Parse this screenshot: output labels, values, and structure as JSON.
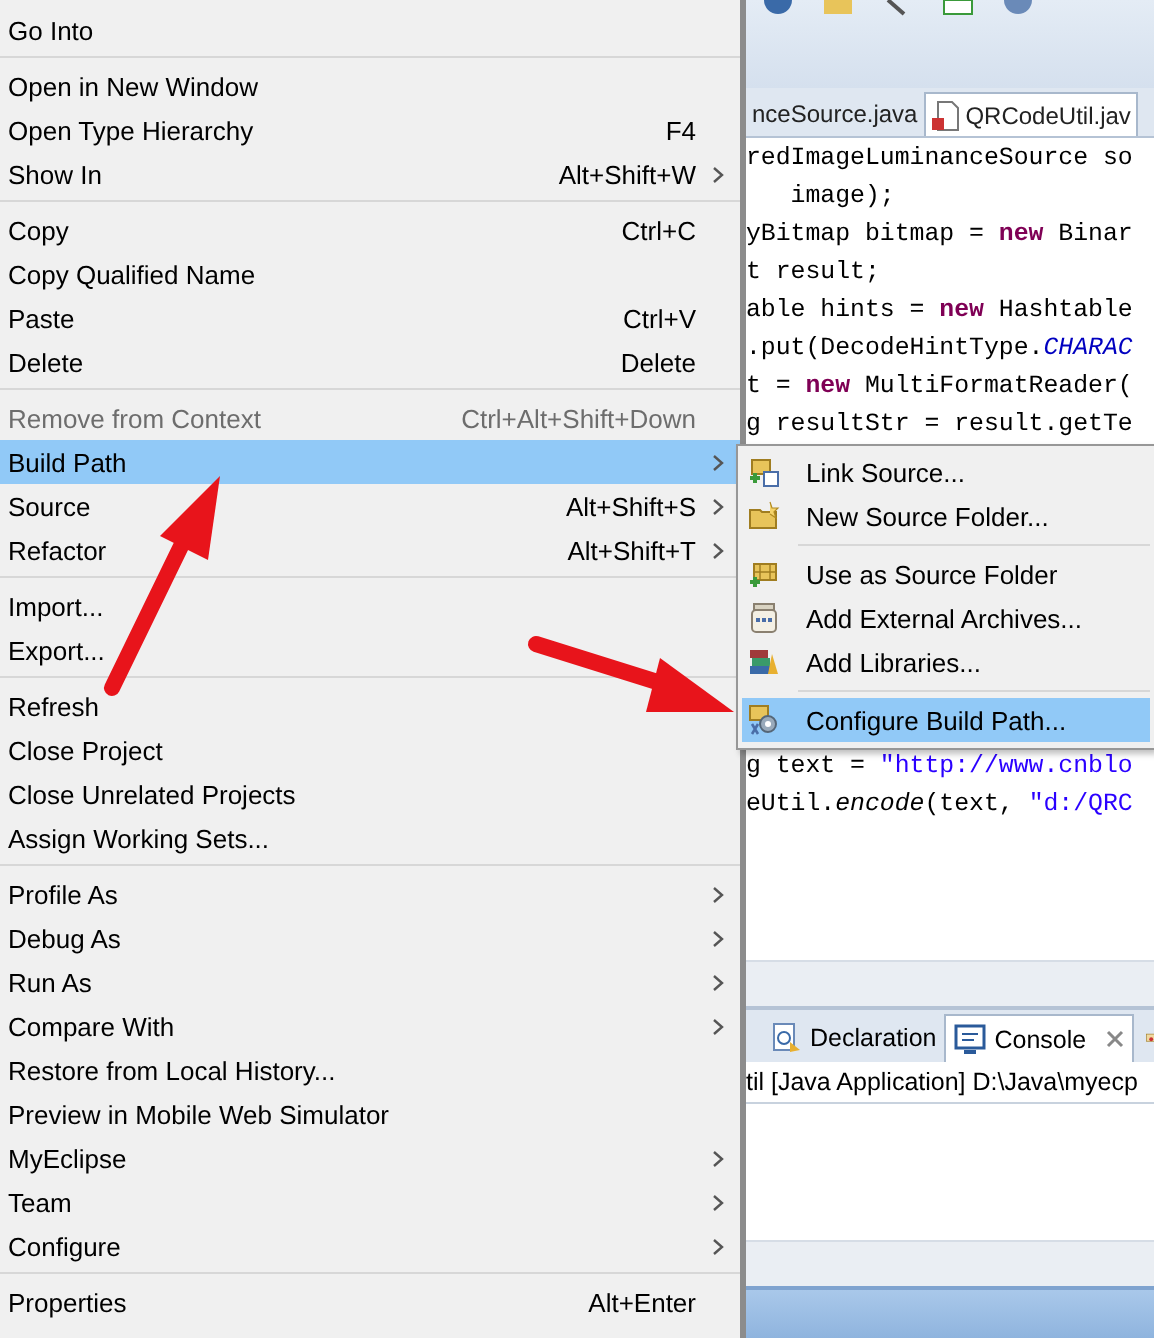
{
  "context_menu": {
    "items": [
      {
        "kind": "item",
        "label": "Go Into",
        "has_submenu": false,
        "disabled": false,
        "selected": false
      },
      {
        "kind": "separator"
      },
      {
        "kind": "item",
        "label": "Open in New Window",
        "has_submenu": false,
        "disabled": false,
        "selected": false
      },
      {
        "kind": "item",
        "label": "Open Type Hierarchy",
        "shortcut": "F4",
        "has_submenu": false,
        "disabled": false,
        "selected": false
      },
      {
        "kind": "item",
        "label": "Show In",
        "shortcut": "Alt+Shift+W",
        "has_submenu": true,
        "disabled": false,
        "selected": false
      },
      {
        "kind": "separator"
      },
      {
        "kind": "item",
        "label": "Copy",
        "shortcut": "Ctrl+C",
        "has_submenu": false,
        "disabled": false,
        "selected": false
      },
      {
        "kind": "item",
        "label": "Copy Qualified Name",
        "has_submenu": false,
        "disabled": false,
        "selected": false
      },
      {
        "kind": "item",
        "label": "Paste",
        "shortcut": "Ctrl+V",
        "has_submenu": false,
        "disabled": false,
        "selected": false
      },
      {
        "kind": "item",
        "label": "Delete",
        "shortcut": "Delete",
        "has_submenu": false,
        "disabled": false,
        "selected": false
      },
      {
        "kind": "separator"
      },
      {
        "kind": "item",
        "label": "Remove from Context",
        "shortcut": "Ctrl+Alt+Shift+Down",
        "has_submenu": false,
        "disabled": true,
        "selected": false
      },
      {
        "kind": "item",
        "label": "Build Path",
        "has_submenu": true,
        "disabled": false,
        "selected": true
      },
      {
        "kind": "item",
        "label": "Source",
        "shortcut": "Alt+Shift+S",
        "has_submenu": true,
        "disabled": false,
        "selected": false
      },
      {
        "kind": "item",
        "label": "Refactor",
        "shortcut": "Alt+Shift+T",
        "has_submenu": true,
        "disabled": false,
        "selected": false
      },
      {
        "kind": "separator"
      },
      {
        "kind": "item",
        "label": "Import...",
        "has_submenu": false,
        "disabled": false,
        "selected": false
      },
      {
        "kind": "item",
        "label": "Export...",
        "has_submenu": false,
        "disabled": false,
        "selected": false
      },
      {
        "kind": "separator"
      },
      {
        "kind": "item",
        "label": "Refresh",
        "has_submenu": false,
        "disabled": false,
        "selected": false
      },
      {
        "kind": "item",
        "label": "Close Project",
        "has_submenu": false,
        "disabled": false,
        "selected": false
      },
      {
        "kind": "item",
        "label": "Close Unrelated Projects",
        "has_submenu": false,
        "disabled": false,
        "selected": false
      },
      {
        "kind": "item",
        "label": "Assign Working Sets...",
        "has_submenu": false,
        "disabled": false,
        "selected": false
      },
      {
        "kind": "separator"
      },
      {
        "kind": "item",
        "label": "Profile As",
        "has_submenu": true,
        "disabled": false,
        "selected": false
      },
      {
        "kind": "item",
        "label": "Debug As",
        "has_submenu": true,
        "disabled": false,
        "selected": false
      },
      {
        "kind": "item",
        "label": "Run As",
        "has_submenu": true,
        "disabled": false,
        "selected": false
      },
      {
        "kind": "item",
        "label": "Compare With",
        "has_submenu": true,
        "disabled": false,
        "selected": false
      },
      {
        "kind": "item",
        "label": "Restore from Local History...",
        "has_submenu": false,
        "disabled": false,
        "selected": false
      },
      {
        "kind": "item",
        "label": "Preview in Mobile Web Simulator",
        "has_submenu": false,
        "disabled": false,
        "selected": false
      },
      {
        "kind": "item",
        "label": "MyEclipse",
        "has_submenu": true,
        "disabled": false,
        "selected": false
      },
      {
        "kind": "item",
        "label": "Team",
        "has_submenu": true,
        "disabled": false,
        "selected": false
      },
      {
        "kind": "item",
        "label": "Configure",
        "has_submenu": true,
        "disabled": false,
        "selected": false
      },
      {
        "kind": "separator"
      },
      {
        "kind": "item",
        "label": "Properties",
        "shortcut": "Alt+Enter",
        "has_submenu": false,
        "disabled": false,
        "selected": false
      }
    ]
  },
  "submenu": {
    "items": [
      {
        "kind": "item",
        "label": "Link Source...",
        "selected": false
      },
      {
        "kind": "item",
        "label": "New Source Folder...",
        "selected": false
      },
      {
        "kind": "separator"
      },
      {
        "kind": "item",
        "label": "Use as Source Folder",
        "selected": false
      },
      {
        "kind": "item",
        "label": "Add External Archives...",
        "selected": false
      },
      {
        "kind": "item",
        "label": "Add Libraries...",
        "selected": false
      },
      {
        "kind": "separator"
      },
      {
        "kind": "item",
        "label": "Configure Build Path...",
        "selected": true
      }
    ]
  },
  "editor": {
    "tabs": [
      {
        "label": "nceSource.java",
        "selected": false
      },
      {
        "label": "QRCodeUtil.jav",
        "selected": true
      }
    ],
    "lines": [
      [
        {
          "kind": "plain",
          "text": "redImageLuminanceSource so"
        }
      ],
      [
        {
          "kind": "plain",
          "text": "   image);"
        }
      ],
      [
        {
          "kind": "plain",
          "text": "yBitmap bitmap = "
        },
        {
          "kind": "keyword",
          "text": "new"
        },
        {
          "kind": "plain",
          "text": " Binar"
        }
      ],
      [
        {
          "kind": "plain",
          "text": "t result;"
        }
      ],
      [
        {
          "kind": "plain",
          "text": "able hints = "
        },
        {
          "kind": "keyword",
          "text": "new"
        },
        {
          "kind": "plain",
          "text": " Hashtable"
        }
      ],
      [
        {
          "kind": "plain",
          "text": ".put(DecodeHintType."
        },
        {
          "kind": "constant",
          "text": "CHARAC"
        }
      ],
      [
        {
          "kind": "plain",
          "text": "t = "
        },
        {
          "kind": "keyword",
          "text": "new"
        },
        {
          "kind": "plain",
          "text": " MultiFormatReader("
        }
      ],
      [
        {
          "kind": "plain",
          "text": "g resultStr = result.getTe"
        }
      ]
    ],
    "lines_below_menu": [
      [
        {
          "kind": "plain",
          "text": "g text = "
        },
        {
          "kind": "string",
          "text": "\"http://www.cnblo"
        }
      ],
      [
        {
          "kind": "plain",
          "text": "eUtil."
        },
        {
          "kind": "method",
          "text": "encode"
        },
        {
          "kind": "plain",
          "text": "(text, "
        },
        {
          "kind": "string",
          "text": "\"d:/QRC"
        }
      ]
    ]
  },
  "views": {
    "tabs": [
      {
        "label": "Declaration",
        "selected": false,
        "closable": false
      },
      {
        "label": "Console",
        "selected": true,
        "closable": true
      }
    ],
    "console_title": "til [Java Application] D:\\Java\\myecp"
  }
}
